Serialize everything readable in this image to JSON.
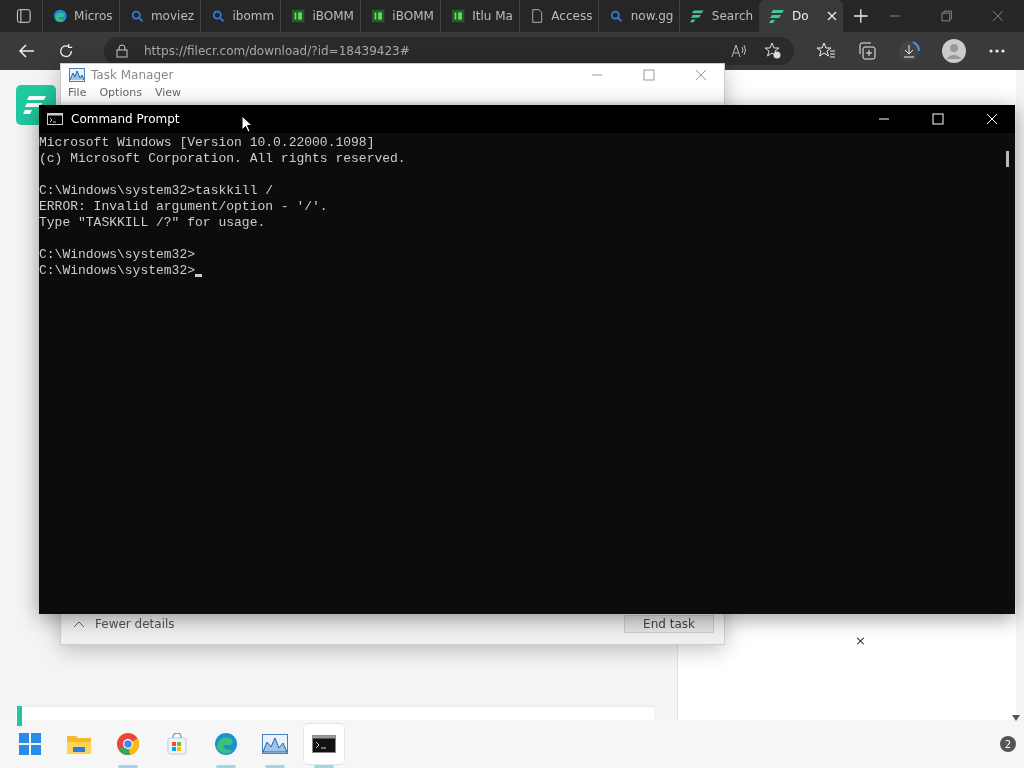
{
  "browser": {
    "tabs": [
      {
        "title": "Micros",
        "kind": "edge",
        "selected": false
      },
      {
        "title": "moviez",
        "kind": "search",
        "selected": false
      },
      {
        "title": "ibomm",
        "kind": "search",
        "selected": false
      },
      {
        "title": "iBOMM",
        "kind": "ib",
        "selected": false
      },
      {
        "title": "iBOMM",
        "kind": "ib",
        "selected": false
      },
      {
        "title": "Itlu Ma",
        "kind": "ib",
        "selected": false
      },
      {
        "title": "Access",
        "kind": "page",
        "selected": false
      },
      {
        "title": "now.gg",
        "kind": "search",
        "selected": false
      },
      {
        "title": "Search",
        "kind": "filecr",
        "selected": false
      },
      {
        "title": "Do",
        "kind": "filecr",
        "selected": true
      }
    ],
    "address": "https://filecr.com/download/?id=18439423#"
  },
  "task_manager": {
    "title": "Task Manager",
    "menu": [
      "File",
      "Options",
      "View"
    ],
    "fewer_details": "Fewer details",
    "end_task": "End task"
  },
  "command_prompt": {
    "title": "Command Prompt",
    "blocks": [
      [
        "Microsoft Windows [Version 10.0.22000.1098]",
        "(c) Microsoft Corporation. All rights reserved."
      ],
      [
        "C:\\Windows\\system32>taskkill /",
        "ERROR: Invalid argument/option - '/'.",
        "Type \"TASKKILL /?\" for usage."
      ],
      [
        "C:\\Windows\\system32>",
        "C:\\Windows\\system32>"
      ]
    ]
  },
  "page": {
    "close": "×"
  },
  "taskbar": {
    "apps": [
      {
        "kind": "start",
        "running": false,
        "selected": false
      },
      {
        "kind": "explorer",
        "running": false,
        "selected": false
      },
      {
        "kind": "chrome",
        "running": true,
        "selected": false
      },
      {
        "kind": "store",
        "running": false,
        "selected": false
      },
      {
        "kind": "edge",
        "running": true,
        "selected": false
      },
      {
        "kind": "taskmgr",
        "running": true,
        "selected": false
      },
      {
        "kind": "cmd",
        "running": true,
        "selected": true
      }
    ],
    "notifications": "2"
  }
}
